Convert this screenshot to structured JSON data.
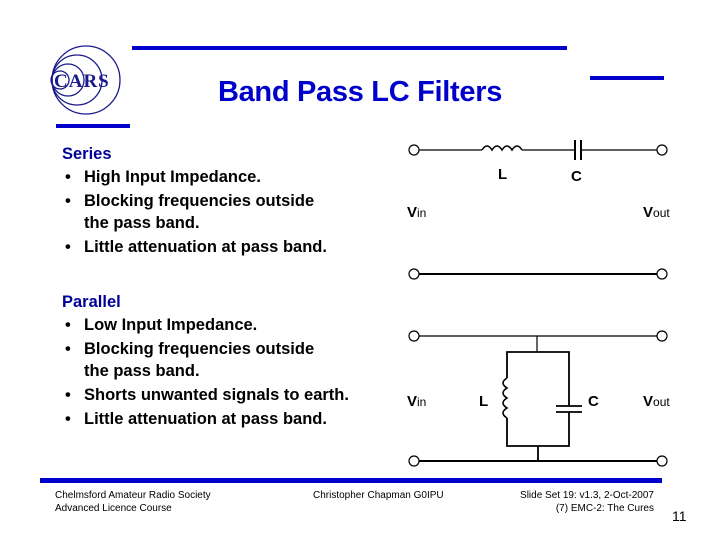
{
  "logo": {
    "text": "CARS"
  },
  "header": {
    "title": "Band Pass LC Filters"
  },
  "series_section": {
    "heading": "Series",
    "bullet_glyph": "•",
    "items": [
      {
        "line1": "High Input Impedance.",
        "line2": ""
      },
      {
        "line1": "Blocking frequencies outside",
        "line2": "the pass band."
      },
      {
        "line1": "Little attenuation at pass band.",
        "line2": ""
      }
    ]
  },
  "parallel_section": {
    "heading": "Parallel",
    "bullet_glyph": "•",
    "items": [
      {
        "line1": "Low Input Impedance.",
        "line2": ""
      },
      {
        "line1": "Blocking frequencies outside",
        "line2": "the pass band."
      },
      {
        "line1": "Shorts unwanted signals to earth.",
        "line2": ""
      },
      {
        "line1": "Little attenuation at pass band.",
        "line2": ""
      }
    ]
  },
  "series_circuit": {
    "inductor_label": "L",
    "capacitor_label": "C",
    "vin_main": "V",
    "vin_sub": "in",
    "vout_main": "V",
    "vout_sub": "out"
  },
  "parallel_circuit": {
    "inductor_label": "L",
    "capacitor_label": "C",
    "vin_main": "V",
    "vin_sub": "in",
    "vout_main": "V",
    "vout_sub": "out"
  },
  "footer": {
    "org_line1": "Chelmsford Amateur Radio Society",
    "org_line2": "Advanced Licence Course",
    "author": "Christopher Chapman G0IPU",
    "slide_set_line1": "Slide Set 19:  v1.3,  2-Oct-2007",
    "slide_set_line2": "(7) EMC-2: The Cures",
    "page_number": "11"
  },
  "colors": {
    "accent": "#0000cc",
    "heading": "#000099",
    "text": "#000000"
  }
}
